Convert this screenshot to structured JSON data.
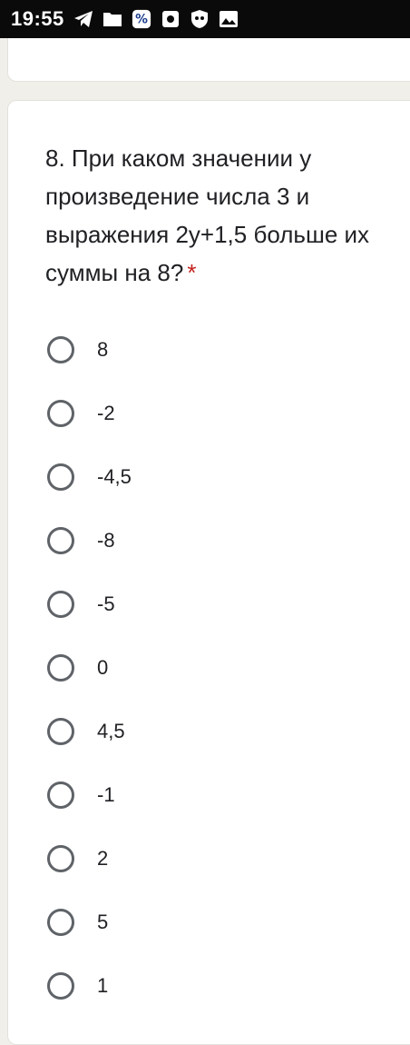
{
  "status_bar": {
    "time": "19:55",
    "icons": [
      "telegram-icon",
      "folder-icon",
      "percent-app-icon",
      "media-icon",
      "shield-app-icon",
      "gallery-icon"
    ]
  },
  "question": {
    "number_text": "8. При каком значении у произведение числа 3 и выражения 2у+1,5 больше их суммы на 8?",
    "required_mark": "*"
  },
  "options": [
    "8",
    "-2",
    "-4,5",
    "-8",
    "-5",
    "0",
    "4,5",
    "-1",
    "2",
    "5",
    "1"
  ],
  "colors": {
    "background": "#f1efe9",
    "card": "#ffffff",
    "required": "#c5221f",
    "radio_border": "#5f6368",
    "status_bar": "#0a0a0a"
  }
}
